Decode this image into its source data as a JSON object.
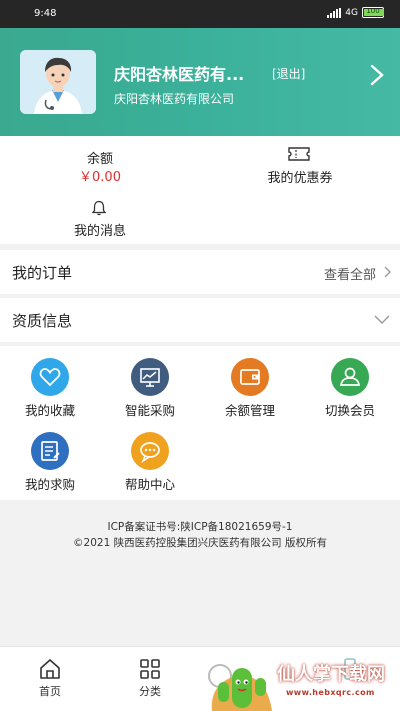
{
  "status_bar": {
    "time": "9:48",
    "network": "4G",
    "battery_level": "100",
    "battery_fraction": 1.0
  },
  "profile": {
    "store_name": "庆阳杏林医药有...",
    "logout_label": "[退出]",
    "company_name": "庆阳杏林医药有限公司",
    "avatar_icon": "doctor-avatar-icon",
    "next_icon": "chevron-right-icon"
  },
  "wallet": {
    "balance_label": "余额",
    "balance_value": "￥0.00",
    "coupon_label": "我的优惠券",
    "coupon_icon": "ticket-icon",
    "message_label": "我的消息",
    "message_icon": "bell-icon"
  },
  "orders": {
    "title": "我的订单",
    "view_all": "查看全部"
  },
  "qualification": {
    "title": "资质信息"
  },
  "tools": [
    {
      "label": "我的收藏",
      "icon": "heart-icon",
      "color": "#2fa7e8"
    },
    {
      "label": "智能采购",
      "icon": "monitor-chart-icon",
      "color": "#405d80"
    },
    {
      "label": "余额管理",
      "icon": "wallet-icon",
      "color": "#e47a22"
    },
    {
      "label": "切换会员",
      "icon": "member-switch-icon",
      "color": "#37a854"
    },
    {
      "label": "我的求购",
      "icon": "edit-document-icon",
      "color": "#2e6fc0"
    },
    {
      "label": "帮助中心",
      "icon": "help-chat-icon",
      "color": "#f0a21f"
    }
  ],
  "footer": {
    "icp": "ICP备案证书号:陕ICP备18021659号-1",
    "copyright": "©2021 陕西医药控股集团兴庆医药有限公司 版权所有"
  },
  "bottom_nav": [
    {
      "label": "首页",
      "icon": "home-icon"
    },
    {
      "label": "分类",
      "icon": "grid-icon"
    }
  ],
  "watermark": {
    "title": "仙人掌下载网",
    "url": "www.hebxqrc.com"
  },
  "colors": {
    "header": "#3bb09a",
    "price": "#e02e2e",
    "background": "#f2f2f2"
  }
}
